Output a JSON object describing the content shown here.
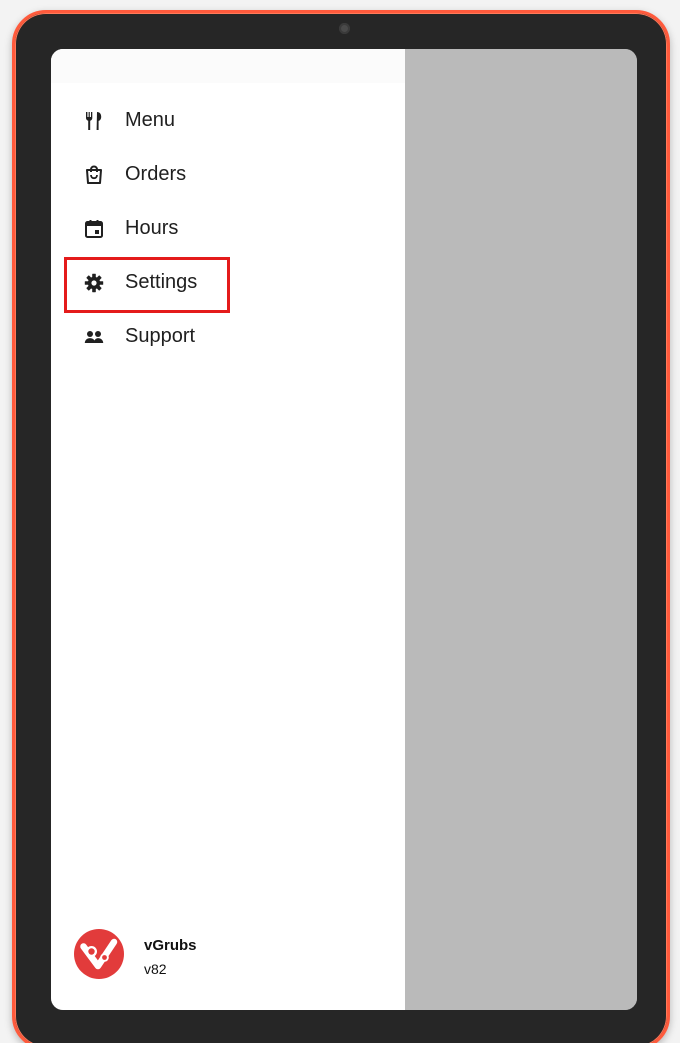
{
  "nav": {
    "items": [
      {
        "label": "Menu",
        "icon": "fork-knife-icon"
      },
      {
        "label": "Orders",
        "icon": "shopping-bag-icon"
      },
      {
        "label": "Hours",
        "icon": "calendar-icon"
      },
      {
        "label": "Settings",
        "icon": "gear-icon",
        "highlighted": true
      },
      {
        "label": "Support",
        "icon": "people-icon"
      }
    ]
  },
  "brand": {
    "name": "vGrubs",
    "version": "v82",
    "logo_icon": "vgrubs-logo-icon"
  },
  "colors": {
    "device_frame": "#ff5a3c",
    "bezel": "#262626",
    "scrim": "#bababa",
    "highlight": "#e41b1b",
    "logo": "#e23b3b"
  }
}
